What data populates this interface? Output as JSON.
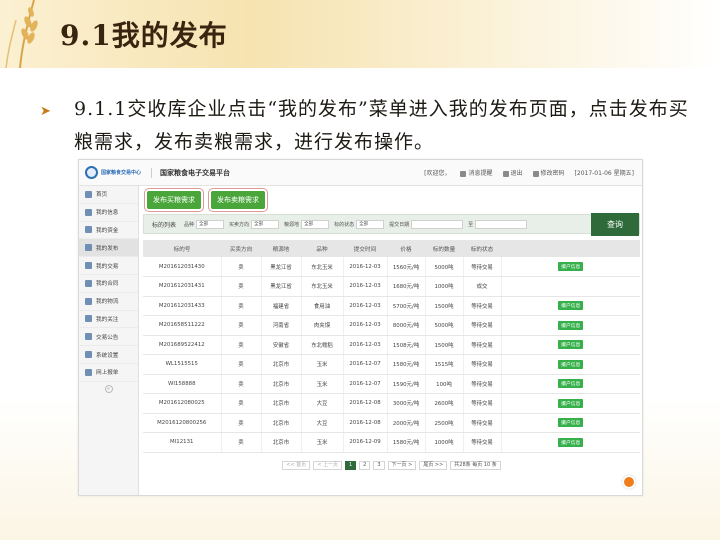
{
  "slide": {
    "title": "9.1我的发布",
    "bullet": "9.1.1交收库企业点击“我的发布”菜单进入我的发布页面，点击发布买粮需求，发布卖粮需求，进行发布操作。"
  },
  "app": {
    "logo_text": "国家粮食交易中心",
    "platform_name": "国家粮食电子交易平台",
    "header": {
      "welcome": "[欢迎您，",
      "remind": "消息提醒",
      "logout": "退出",
      "change_password": "修改密码",
      "date": "[2017-01-06 星期五]"
    },
    "sidebar": [
      {
        "label": "首页"
      },
      {
        "label": "我的信息"
      },
      {
        "label": "我的资金"
      },
      {
        "label": "我的发布"
      },
      {
        "label": "我的交易"
      },
      {
        "label": "我的合同"
      },
      {
        "label": "我的物流"
      },
      {
        "label": "我的关注"
      },
      {
        "label": "交易公告"
      },
      {
        "label": "系统设置"
      },
      {
        "label": "网上报单"
      }
    ],
    "buttons": {
      "publish_buy": "发布买粮需求",
      "publish_sell": "发布卖粮需求",
      "query": "查询"
    },
    "filter": {
      "list_label": "标的列表",
      "fields": [
        {
          "label": "品种",
          "value": "全部"
        },
        {
          "label": "买卖方向",
          "value": "全部"
        },
        {
          "label": "粮源地",
          "value": "全部"
        },
        {
          "label": "标的状态",
          "value": "全部"
        },
        {
          "label": "提交日期",
          "value": ""
        },
        {
          "label": "至",
          "value": ""
        }
      ]
    },
    "table": {
      "headers": [
        "标的号",
        "买卖方向",
        "粮源地",
        "品种",
        "提交时间",
        "价格",
        "标的数量",
        "标的状态",
        ""
      ],
      "rows": [
        [
          "M201612031430",
          "卖",
          "黑龙江省",
          "东北玉米",
          "2016-12-03",
          "1560元/吨",
          "5000吨",
          "等待交易",
          "撮户信息"
        ],
        [
          "M201612031431",
          "卖",
          "黑龙江省",
          "东北玉米",
          "2016-12-03",
          "1680元/吨",
          "1000吨",
          "成交",
          ""
        ],
        [
          "M201612031433",
          "卖",
          "福建省",
          "食用油",
          "2016-12-03",
          "5700元/吨",
          "1500吨",
          "等待交易",
          "撮户信息"
        ],
        [
          "M201658511222",
          "卖",
          "河南省",
          "肉夹馍",
          "2016-12-03",
          "8000元/吨",
          "5000吨",
          "等待交易",
          "撮户信息"
        ],
        [
          "M201689522412",
          "卖",
          "安徽省",
          "东北糯稻",
          "2016-12-03",
          "1508元/吨",
          "1500吨",
          "等待交易",
          "撮户信息"
        ],
        [
          "WL151551​5",
          "卖",
          "北京市",
          "玉米",
          "2016-12-07",
          "1580元/吨",
          "1515吨",
          "等待交易",
          "撮户信息"
        ],
        [
          "WI158888",
          "卖",
          "北京市",
          "玉米",
          "2016-12-07",
          "1590元/吨",
          "100吨",
          "等待交易",
          "撮户信息"
        ],
        [
          "M201612080025",
          "卖",
          "北京市",
          "大豆",
          "2016-12-08",
          "3000元/吨",
          "2600吨",
          "等待交易",
          "撮户信息"
        ],
        [
          "M2016120800256",
          "卖",
          "北京市",
          "大豆",
          "2016-12-08",
          "2000元/吨",
          "2500吨",
          "等待交易",
          "撮户信息"
        ],
        [
          "MI12131",
          "卖",
          "北京市",
          "玉米",
          "2016-12-09",
          "1580元/吨",
          "1000吨",
          "等待交易",
          "撮户信息"
        ]
      ]
    },
    "pager": {
      "first": "<< 首页",
      "prev": "< 上一页",
      "pages": [
        "1",
        "2",
        "3"
      ],
      "next": "下一页 >",
      "last": "尾页 >>",
      "summary": "共28条 每页 10 条"
    }
  }
}
